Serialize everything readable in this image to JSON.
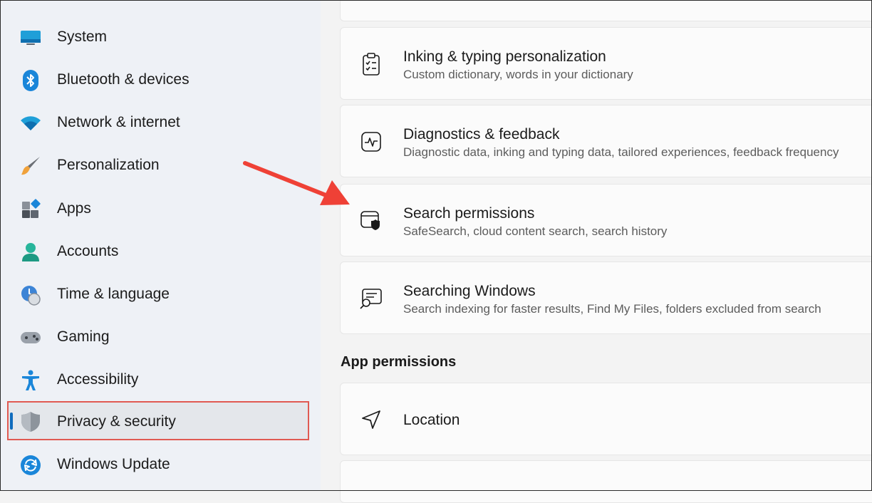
{
  "sidebar": {
    "items": [
      {
        "label": "System",
        "icon": "monitor-icon"
      },
      {
        "label": "Bluetooth & devices",
        "icon": "bluetooth-icon"
      },
      {
        "label": "Network & internet",
        "icon": "wifi-icon"
      },
      {
        "label": "Personalization",
        "icon": "brush-icon"
      },
      {
        "label": "Apps",
        "icon": "apps-icon"
      },
      {
        "label": "Accounts",
        "icon": "person-icon"
      },
      {
        "label": "Time & language",
        "icon": "clock-globe-icon"
      },
      {
        "label": "Gaming",
        "icon": "gamepad-icon"
      },
      {
        "label": "Accessibility",
        "icon": "accessibility-icon"
      },
      {
        "label": "Privacy & security",
        "icon": "shield-icon",
        "selected": true
      },
      {
        "label": "Windows Update",
        "icon": "sync-icon"
      }
    ]
  },
  "main": {
    "cards": [
      {
        "title": "Inking & typing personalization",
        "subtitle": "Custom dictionary, words in your dictionary",
        "icon": "clipboard-check-icon"
      },
      {
        "title": "Diagnostics & feedback",
        "subtitle": "Diagnostic data, inking and typing data, tailored experiences, feedback frequency",
        "icon": "pulse-icon"
      },
      {
        "title": "Search permissions",
        "subtitle": "SafeSearch, cloud content search, search history",
        "icon": "search-shield-icon"
      },
      {
        "title": "Searching Windows",
        "subtitle": "Search indexing for faster results, Find My Files, folders excluded from search",
        "icon": "search-windows-icon"
      }
    ],
    "section_title": "App permissions",
    "location_card": {
      "title": "Location",
      "icon": "location-arrow-icon"
    }
  },
  "colors": {
    "accent": "#0f6cbd",
    "highlight_box": "#e05a52",
    "annotation_arrow": "#ef4136"
  }
}
